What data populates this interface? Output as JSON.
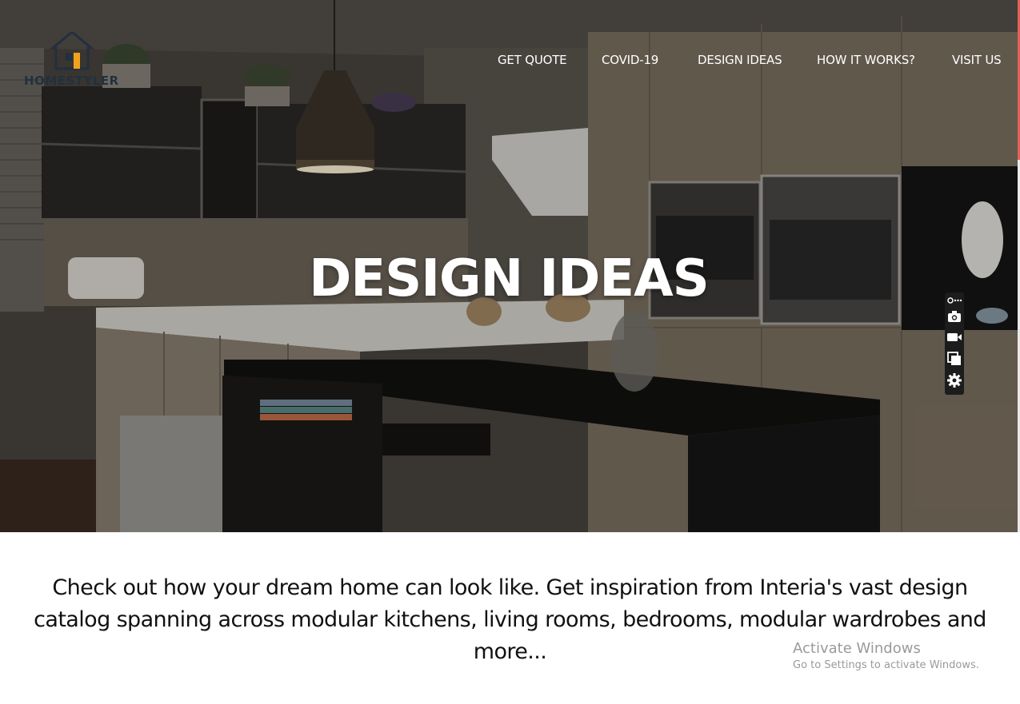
{
  "brand": {
    "name": "HOMESTYLER"
  },
  "nav": {
    "items": [
      {
        "label": "GET QUOTE"
      },
      {
        "label": "COVID-19"
      },
      {
        "label": "DESIGN IDEAS"
      },
      {
        "label": "HOW IT WORKS?"
      },
      {
        "label": "VISIT US"
      }
    ]
  },
  "hero": {
    "title": "DESIGN IDEAS"
  },
  "description": {
    "text": "Check out how your dream home can look like. Get inspiration from Interia's vast design catalog spanning across modular kitchens, living rooms, bedrooms, modular wardrobes and more..."
  },
  "toolbar": {
    "icons": [
      "link-more-icon",
      "camera-icon",
      "video-icon",
      "copy-icon",
      "gear-icon"
    ]
  },
  "watermark": {
    "title": "Activate Windows",
    "subtitle": "Go to Settings to activate Windows."
  },
  "colors": {
    "accent": "#e0625a",
    "logo_orange": "#f0a21f",
    "logo_navy": "#22303f"
  }
}
